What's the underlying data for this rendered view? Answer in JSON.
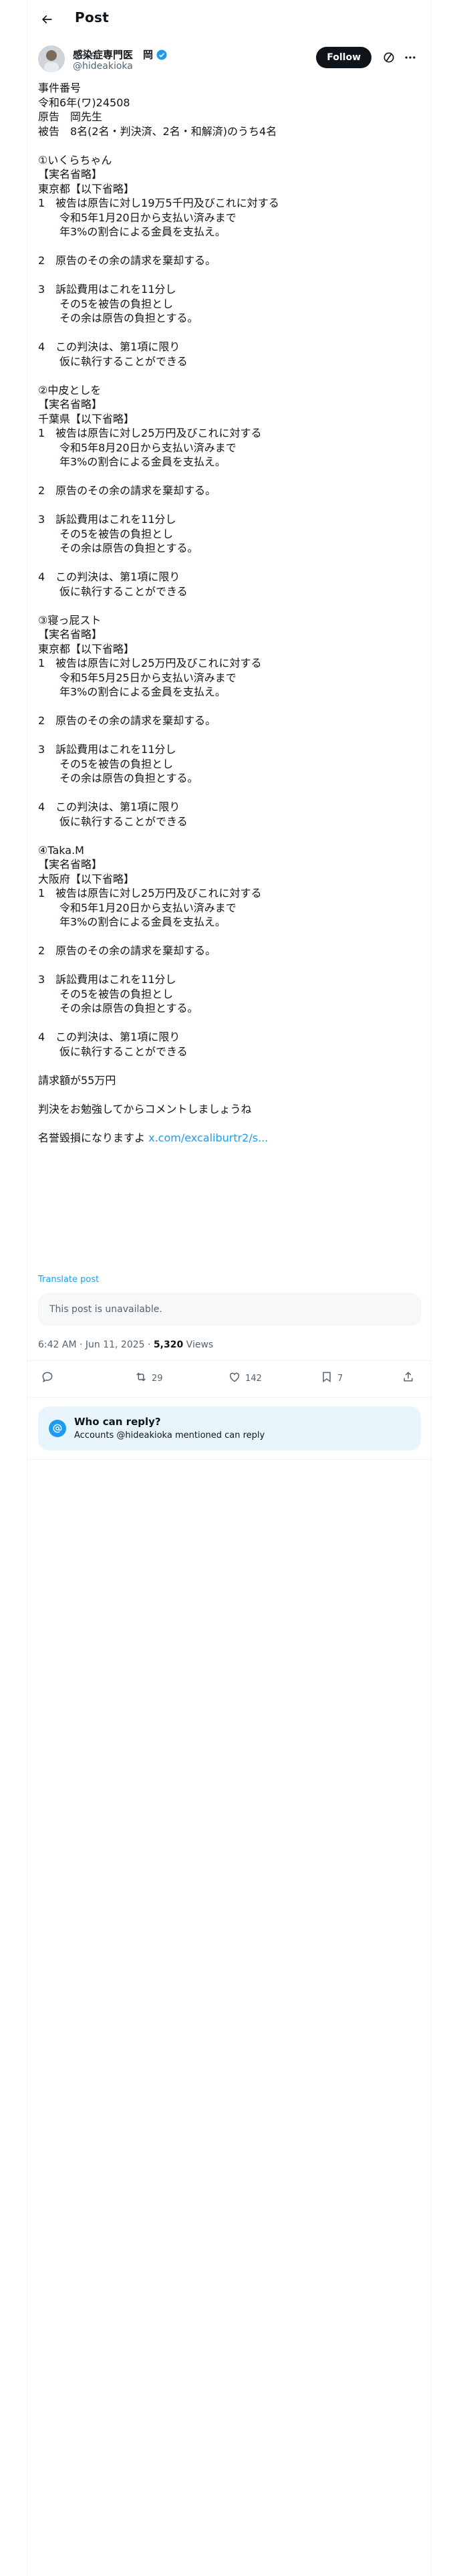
{
  "header": {
    "title": "Post"
  },
  "author": {
    "display_name": "感染症専門医　岡",
    "handle": "@hideakioka",
    "follow_label": "Follow"
  },
  "tweet": {
    "body": "事件番号\n令和6年(ワ)24508\n原告　岡先生\n被告　8名(2名・判決済、2名・和解済)のうち4名\n\n①いくらちゃん\n【実名省略】\n東京都【以下省略】\n1　被告は原告に対し19万5千円及びこれに対する\n　　令和5年1月20日から支払い済みまで\n　　年3%の割合による金員を支払え。\n\n2　原告のその余の請求を棄却する。\n\n3　訴訟費用はこれを11分し\n　　その5を被告の負担とし\n　　その余は原告の負担とする。\n\n4　この判決は、第1項に限り\n　　仮に執行することができる\n\n②中皮としを\n【実名省略】\n千葉県【以下省略】\n1　被告は原告に対し25万円及びこれに対する\n　　令和5年8月20日から支払い済みまで\n　　年3%の割合による金員を支払え。\n\n2　原告のその余の請求を棄却する。\n\n3　訴訟費用はこれを11分し\n　　その5を被告の負担とし\n　　その余は原告の負担とする。\n\n4　この判決は、第1項に限り\n　　仮に執行することができる\n\n③寝っ屁スト\n【実名省略】\n東京都【以下省略】\n1　被告は原告に対し25万円及びこれに対する\n　　令和5年5月25日から支払い済みまで\n　　年3%の割合による金員を支払え。\n\n2　原告のその余の請求を棄却する。\n\n3　訴訟費用はこれを11分し\n　　その5を被告の負担とし\n　　その余は原告の負担とする。\n\n4　この判決は、第1項に限り\n　　仮に執行することができる\n\n④Taka.M\n【実名省略】\n大阪府【以下省略】\n1　被告は原告に対し25万円及びこれに対する\n　　令和5年1月20日から支払い済みまで\n　　年3%の割合による金員を支払え。\n\n2　原告のその余の請求を棄却する。\n\n3　訴訟費用はこれを11分し\n　　その5を被告の負担とし\n　　その余は原告の負担とする。\n\n4　この判決は、第1項に限り\n　　仮に執行することができる\n\n請求額が55万円\n\n判決をお勉強してからコメントしましょうね\n\n名誉毀損になりますよ ",
    "link_text": "x.com/excaliburtr2/s...",
    "translate_label": "Translate post",
    "quote_unavailable": "This post is unavailable.",
    "timestamp": "6:42 AM · Jun 11, 2025 · ",
    "views_count": "5,320",
    "views_label": " Views"
  },
  "actions": {
    "replies": "",
    "reposts": "29",
    "likes": "142",
    "bookmarks": "7"
  },
  "reply_restriction": {
    "title": "Who can reply?",
    "subtitle": "Accounts @hideakioka mentioned can reply"
  },
  "colors": {
    "accent": "#1d9bf0",
    "text": "#0f1419",
    "muted": "#536471"
  }
}
